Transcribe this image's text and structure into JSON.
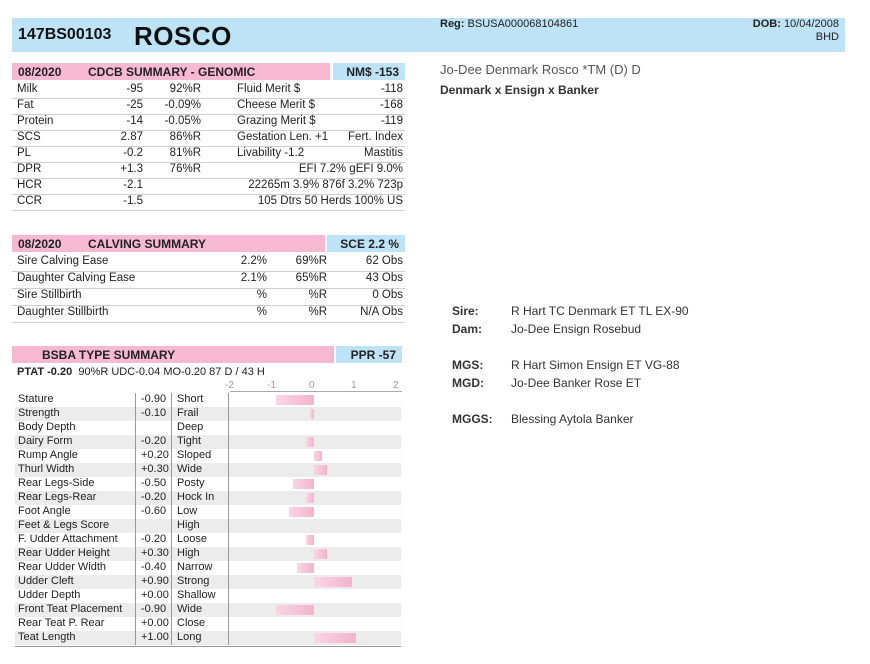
{
  "header": {
    "code": "147BS00103",
    "name": "ROSCO",
    "reg_label": "Reg:",
    "reg_value": "BSUSA000068104861",
    "dob_label": "DOB:",
    "dob_value": "10/04/2008",
    "bhd": "BHD"
  },
  "genomic": {
    "date": "08/2020",
    "title": "CDCB SUMMARY - GENOMIC",
    "nm": "NM$ -153",
    "rows": [
      {
        "trait": "Milk",
        "val": "-95",
        "rel": "92%R",
        "m_label": "Fluid Merit $",
        "m_val": "-118"
      },
      {
        "trait": "Fat",
        "val": "-25",
        "rel": "-0.09%",
        "m_label": "Cheese Merit $",
        "m_val": "-168"
      },
      {
        "trait": "Protein",
        "val": "-14",
        "rel": "-0.05%",
        "m_label": "Grazing Merit $",
        "m_val": "-119"
      },
      {
        "trait": "SCS",
        "val": "2.87",
        "rel": "86%R",
        "m_label": "Gestation Len. +1",
        "m_val": "Fert. Index"
      },
      {
        "trait": "PL",
        "val": "-0.2",
        "rel": "81%R",
        "m_label": "Livability  -1.2",
        "m_val": "Mastitis"
      },
      {
        "trait": "DPR",
        "val": "+1.3",
        "rel": "76%R",
        "m_label": "EFI  7.2%  gEFI  9.0%",
        "m_val": ""
      },
      {
        "trait": "HCR",
        "val": "-2.1",
        "rel": "",
        "m_label": "22265m  3.9%  876f  3.2%  723p",
        "m_val": ""
      },
      {
        "trait": "CCR",
        "val": "-1.5",
        "rel": "",
        "m_label": "105 Dtrs  50 Herds  100% US",
        "m_val": ""
      }
    ]
  },
  "calving": {
    "date": "08/2020",
    "title": "CALVING SUMMARY",
    "sce": "SCE 2.2 %",
    "rows": [
      {
        "trait": "Sire Calving Ease",
        "pct": "2.2%",
        "rel": "69%R",
        "obs": "62 Obs"
      },
      {
        "trait": "Daughter Calving Ease",
        "pct": "2.1%",
        "rel": "65%R",
        "obs": "43 Obs"
      },
      {
        "trait": "Sire Stillbirth",
        "pct": "%",
        "rel": "%R",
        "obs": "0 Obs"
      },
      {
        "trait": "Daughter Stillbirth",
        "pct": "%",
        "rel": "%R",
        "obs": "N/A Obs"
      }
    ]
  },
  "type": {
    "title": "BSBA TYPE SUMMARY",
    "ppr": "PPR -57",
    "ptat_label": "PTAT -0.20",
    "summary": "90%R  UDC-0.04  MO-0.20    87 D /  43 H",
    "scale": [
      "-2",
      "-1",
      "0",
      "1",
      "2"
    ],
    "traits": [
      {
        "name": "Stature",
        "val": "-0.90",
        "desc": "Short",
        "v": -0.9
      },
      {
        "name": "Strength",
        "val": "-0.10",
        "desc": "Frail",
        "v": -0.1
      },
      {
        "name": "Body Depth",
        "val": "",
        "desc": "Deep",
        "v": 0
      },
      {
        "name": "Dairy Form",
        "val": "-0.20",
        "desc": "Tight",
        "v": -0.2
      },
      {
        "name": "Rump Angle",
        "val": "+0.20",
        "desc": "Sloped",
        "v": 0.2
      },
      {
        "name": "Thurl Width",
        "val": "+0.30",
        "desc": "Wide",
        "v": 0.3
      },
      {
        "name": "Rear Legs-Side",
        "val": "-0.50",
        "desc": "Posty",
        "v": -0.5
      },
      {
        "name": "Rear Legs-Rear",
        "val": "-0.20",
        "desc": "Hock In",
        "v": -0.2
      },
      {
        "name": "Foot Angle",
        "val": "-0.60",
        "desc": "Low",
        "v": -0.6
      },
      {
        "name": "Feet & Legs Score",
        "val": "",
        "desc": "High",
        "v": 0
      },
      {
        "name": "F. Udder Attachment",
        "val": "-0.20",
        "desc": "Loose",
        "v": -0.2
      },
      {
        "name": "Rear Udder Height",
        "val": "+0.30",
        "desc": "High",
        "v": 0.3
      },
      {
        "name": "Rear Udder Width",
        "val": "-0.40",
        "desc": "Narrow",
        "v": -0.4
      },
      {
        "name": "Udder Cleft",
        "val": "+0.90",
        "desc": "Strong",
        "v": 0.9
      },
      {
        "name": "Udder Depth",
        "val": "+0.00",
        "desc": "Shallow",
        "v": 0
      },
      {
        "name": "Front Teat Placement",
        "val": "-0.90",
        "desc": "Wide",
        "v": -0.9
      },
      {
        "name": "Rear Teat P. Rear",
        "val": "+0.00",
        "desc": "Close",
        "v": 0
      },
      {
        "name": "Teat Length",
        "val": "+1.00",
        "desc": "Long",
        "v": 1.0
      }
    ]
  },
  "pedigree": {
    "full_name": "Jo-Dee Denmark Rosco *TM (D)  D",
    "lineage": "Denmark x Ensign x Banker",
    "items": [
      {
        "label": "Sire:",
        "value": "R Hart TC Denmark ET TL EX-90"
      },
      {
        "label": "Dam:",
        "value": "Jo-Dee Ensign Rosebud"
      },
      {
        "label": "MGS:",
        "value": "R Hart Simon Ensign ET VG-88"
      },
      {
        "label": "MGD:",
        "value": "Jo-Dee Banker Rose ET"
      },
      {
        "label": "MGGS:",
        "value": "Blessing Aytola Banker"
      }
    ]
  }
}
